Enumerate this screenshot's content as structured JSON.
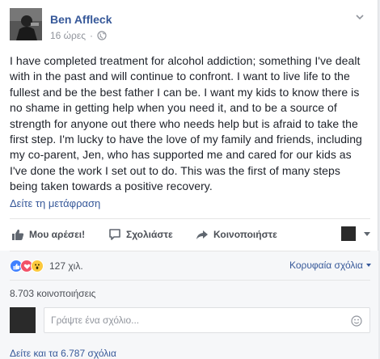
{
  "post": {
    "author": "Ben Affleck",
    "time": "16 ώρες",
    "privacy_separator": "·",
    "privacy_icon": "globe-icon",
    "text": "I have completed treatment for alcohol addiction; something I've dealt with in the past and will continue to confront. I want to live life to the fullest and be the best father I can be. I want my kids to know there is no shame in getting help when you need it, and to be a source of strength for anyone out there who needs help but is afraid to take the first step. I'm lucky to have the love of my family and friends, including my co-parent, Jen, who has supported me and cared for our kids as I've done the work I set out to do. This was the first of many steps being taken towards a positive recovery.",
    "translate_link": "Δείτε τη μετάφραση"
  },
  "actions": {
    "like_label": "Μου αρέσει!",
    "comment_label": "Σχολιάστε",
    "share_label": "Κοινοποιήστε"
  },
  "reactions": {
    "icons": [
      "like-icon",
      "love-icon",
      "wow-icon"
    ],
    "count": "127 χιλ.",
    "top_comments_label": "Κορυφαία σχόλια"
  },
  "shares": {
    "label": "8.703 κοινοποιήσεις"
  },
  "comment_box": {
    "placeholder": "Γράψτε ένα σχόλιο..."
  },
  "comments": {
    "view_more": "Δείτε και τα 6.787 σχόλια"
  },
  "colors": {
    "link": "#365899",
    "secondary_text": "#90949c",
    "like_blue": "#4080ff",
    "love_red": "#f25268",
    "wow_yellow": "#fcc93d"
  }
}
